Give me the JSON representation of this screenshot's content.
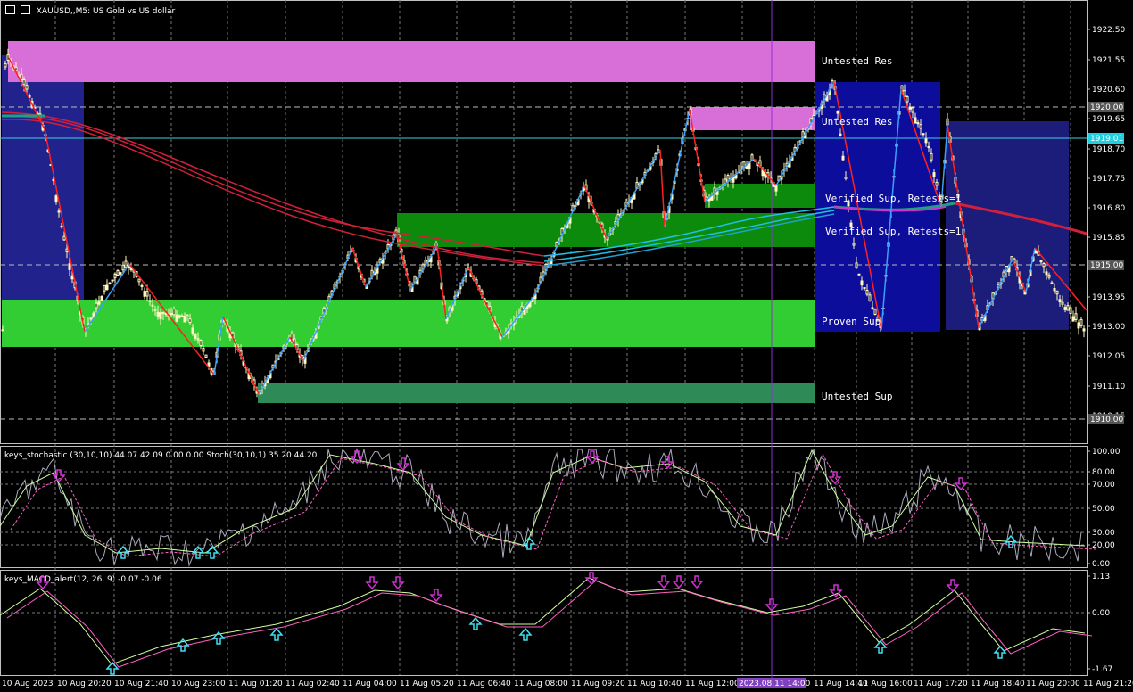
{
  "window": {
    "symbol_title": "XAUUSD,,M5:  US Gold vs US dollar",
    "stoch_title": "keys_stochastic (30,10,10) 44.07 42.09 0.00 0.00 Stoch(30,10,1) 35.20 44.20",
    "macd_title": "keys_MACD_alert(12, 26, 9) -0.07 -0.06"
  },
  "price_axis": {
    "labels": [
      "1922.50",
      "1921.55",
      "1920.60",
      "1919.65",
      "1918.70",
      "1917.75",
      "1916.80",
      "1915.85",
      "1913.95",
      "1913.00",
      "1912.05",
      "1911.10",
      "1910.15"
    ],
    "marker_labels": [
      "1920.00",
      "1915.00",
      "1910.00"
    ],
    "current_price": "1919.01"
  },
  "stoch_axis": {
    "labels": [
      "100.00",
      "80.00",
      "70.00",
      "50.00",
      "30.00",
      "20.00",
      "0.00"
    ]
  },
  "macd_axis": {
    "labels": [
      "1.13",
      "0.00",
      "-1.67"
    ]
  },
  "time_axis": {
    "labels": [
      "10 Aug 2023",
      "10 Aug 20:20",
      "10 Aug 21:40",
      "10 Aug 23:00",
      "11 Aug 01:20",
      "11 Aug 02:40",
      "11 Aug 04:00",
      "11 Aug 05:20",
      "11 Aug 06:40",
      "11 Aug 08:00",
      "11 Aug 09:20",
      "11 Aug 10:40",
      "11 Aug 12:00",
      "11 Aug 14:40",
      "11 Aug 16:00",
      "11 Aug 17:20",
      "11 Aug 18:40",
      "11 Aug 20:00",
      "11 Aug 21:20"
    ],
    "cursor_time": "2023.08.11 14:00"
  },
  "zones": [
    {
      "label": "Untested Res",
      "color": "#d86fd8"
    },
    {
      "label": "Untested Res",
      "color": "#d86fd8"
    },
    {
      "label": "Verified Sup, Retests=1",
      "color": "#0b8a0b"
    },
    {
      "label": "Verified Sup, Retests=1",
      "color": "#0b8a0b"
    },
    {
      "label": "Proven Sup",
      "color": "#32cd32"
    },
    {
      "label": "Untested Sup",
      "color": "#2e8b57"
    }
  ],
  "colors": {
    "up_arrow": "#3fe0f0",
    "down_arrow": "#d030d0",
    "zigzag_up": "#3aa0ff",
    "zigzag_down": "#ff2020",
    "ma_red": "#d0203a",
    "ma_cyan": "#20c0e0"
  }
}
